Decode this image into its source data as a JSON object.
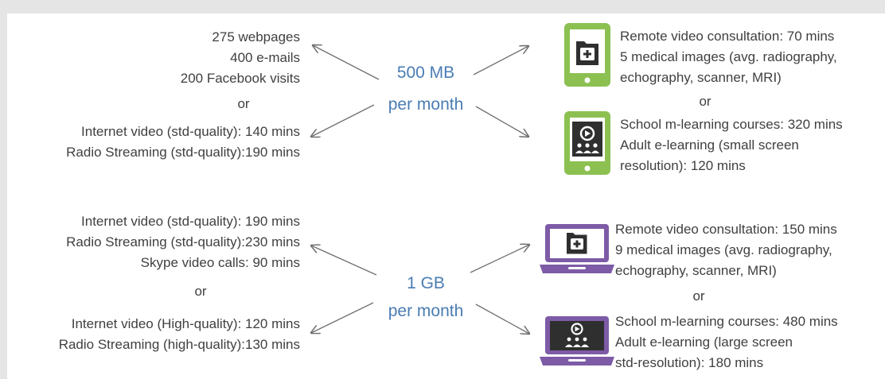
{
  "colors": {
    "caption_blue": "#4a7cb3",
    "text_gray": "#404040",
    "tablet_green": "#8cc152",
    "laptop_purple": "#7d5ba6",
    "arrow_gray": "#707070",
    "frame_gray": "#e5e5e5"
  },
  "top": {
    "caption": {
      "line1": "500 MB",
      "line2": "per month"
    },
    "left": {
      "lines_a": [
        "275 webpages",
        "400 e-mails",
        "200 Facebook visits"
      ],
      "or": "or",
      "lines_b": [
        "Internet video (std-quality): 140 mins",
        "Radio Streaming (std-quality):190 mins"
      ]
    },
    "right": {
      "block_a": [
        "Remote video consultation: 70 mins",
        "5 medical images (avg. radiography,",
        "echography, scanner, MRI)"
      ],
      "or": "or",
      "block_b": [
        "School m-learning courses: 320 mins",
        "Adult e-learning (small screen",
        "resolution): 120 mins"
      ],
      "icon_a": "tablet-medical-kit-icon",
      "icon_b": "tablet-video-classroom-icon"
    }
  },
  "bottom": {
    "caption": {
      "line1": "1 GB",
      "line2": "per month"
    },
    "left": {
      "lines_a": [
        "Internet video (std-quality): 190 mins",
        "Radio Streaming (std-quality):230 mins",
        "Skype video calls: 90 mins"
      ],
      "or": "or",
      "lines_b": [
        "Internet video (High-quality): 120 mins",
        "Radio Streaming (high-quality):130 mins"
      ]
    },
    "right": {
      "block_a": [
        "Remote video consultation: 150 mins",
        "9 medical images (avg. radiography,",
        "echography, scanner, MRI)"
      ],
      "or": "or",
      "block_b": [
        "School m-learning courses: 480 mins",
        "Adult e-learning (large screen",
        "std-resolution): 180 mins"
      ],
      "icon_a": "laptop-medical-kit-icon",
      "icon_b": "laptop-video-classroom-icon"
    }
  }
}
